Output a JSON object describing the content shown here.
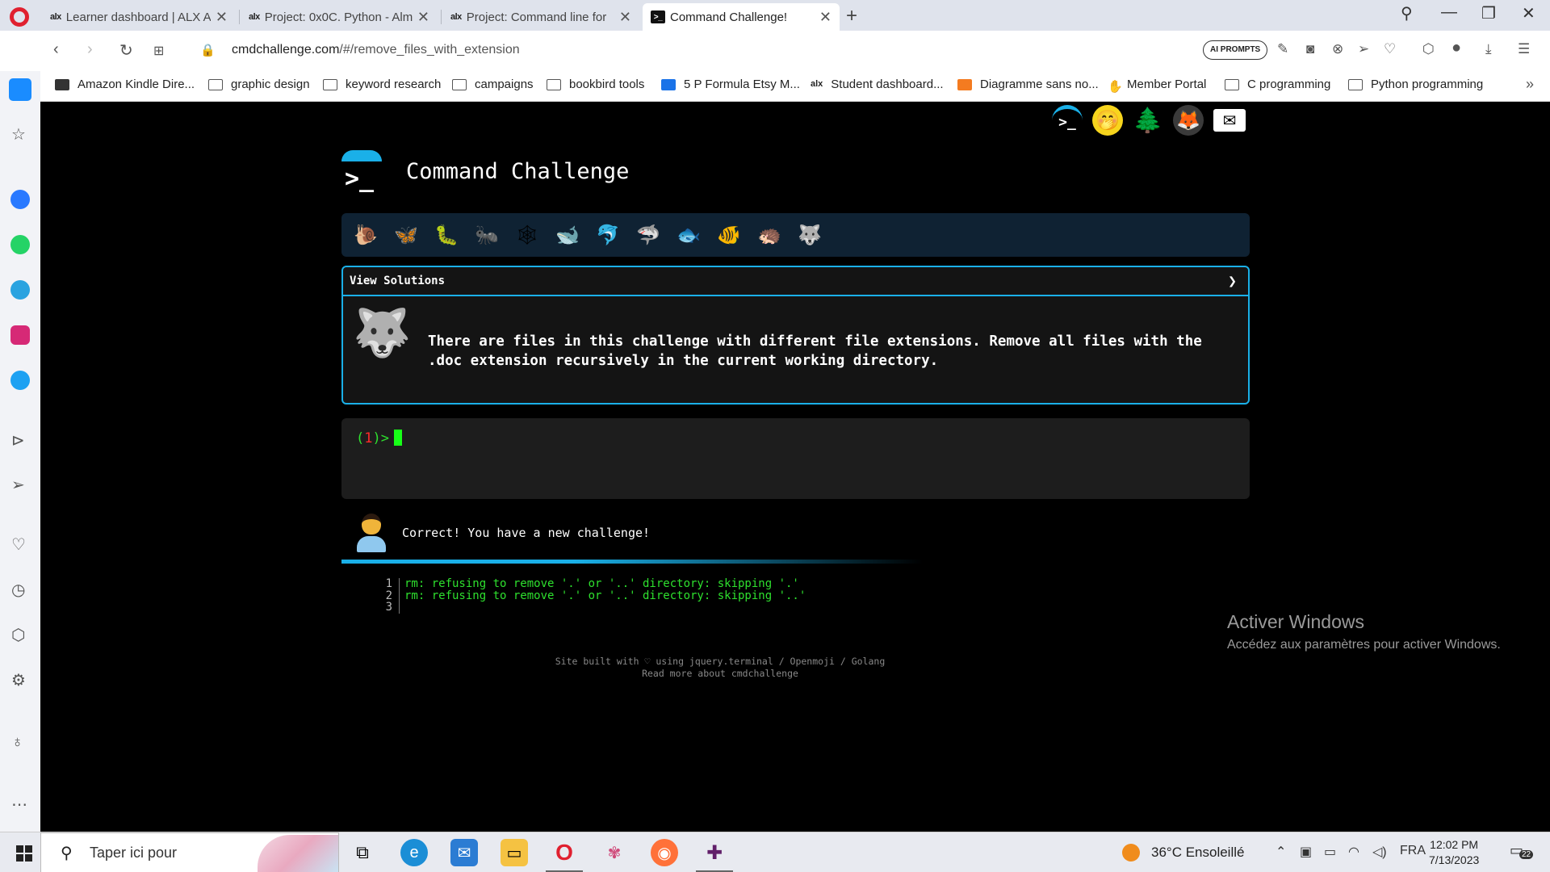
{
  "browser": {
    "tabs": [
      {
        "favicon": "alx",
        "title": "Learner dashboard | ALX Ai",
        "active": false
      },
      {
        "favicon": "alx",
        "title": "Project: 0x0C. Python - Alm",
        "active": false
      },
      {
        "favicon": "alx",
        "title": "Project: Command line for",
        "active": false
      },
      {
        "favicon": ">_",
        "title": "Command Challenge!",
        "active": true
      }
    ],
    "new_tab_label": "+",
    "url_host": "cmdchallenge.com",
    "url_path": "/#/remove_files_with_extension",
    "ai_prompts_label": "AI PROMPTS"
  },
  "bookmarks": [
    {
      "label": "Amazon Kindle Dire...",
      "icon": "image-icon"
    },
    {
      "label": "graphic design",
      "icon": "folder-icon"
    },
    {
      "label": "keyword research",
      "icon": "folder-icon"
    },
    {
      "label": "campaigns",
      "icon": "folder-icon"
    },
    {
      "label": "bookbird tools",
      "icon": "folder-icon"
    },
    {
      "label": "5 P Formula Etsy M...",
      "icon": "blue-icon"
    },
    {
      "label": "Student dashboard...",
      "icon": "alx-icon"
    },
    {
      "label": "Diagramme sans no...",
      "icon": "orange-icon"
    },
    {
      "label": "Member Portal",
      "icon": "hand-icon"
    },
    {
      "label": "C programming",
      "icon": "folder-icon"
    },
    {
      "label": "Python programming",
      "icon": "folder-icon"
    }
  ],
  "page": {
    "brand_title": "Command Challenge",
    "view_solutions": "View Solutions",
    "challenge_text": "There are files in this challenge with different file extensions. Remove all files with the .doc extension recursively in the current working directory.",
    "prompt_prefix": "(",
    "prompt_num": "1",
    "prompt_suffix": ")>",
    "feedback": "Correct! You have a new challenge!",
    "output": [
      {
        "n": "1",
        "text": "rm: refusing to remove '.' or '..' directory: skipping '.'"
      },
      {
        "n": "2",
        "text": "rm: refusing to remove '.' or '..' directory: skipping '..'"
      },
      {
        "n": "3",
        "text": ""
      }
    ],
    "footer_line1": "Site built with ♡ using jquery.terminal / Openmoji / Golang",
    "footer_line2": "Read more about cmdchallenge"
  },
  "activate_windows": {
    "title": "Activer Windows",
    "subtitle": "Accédez aux paramètres pour activer Windows."
  },
  "taskbar": {
    "search_placeholder": "Taper ici pour",
    "weather": "36°C  Ensoleillé",
    "language": "FRA",
    "time": "12:02 PM",
    "date": "7/13/2023",
    "notifications": "22"
  },
  "colors": {
    "accent": "#1ab0e8",
    "terminal_green": "#2ee02e",
    "opera_red": "#e0202f"
  }
}
